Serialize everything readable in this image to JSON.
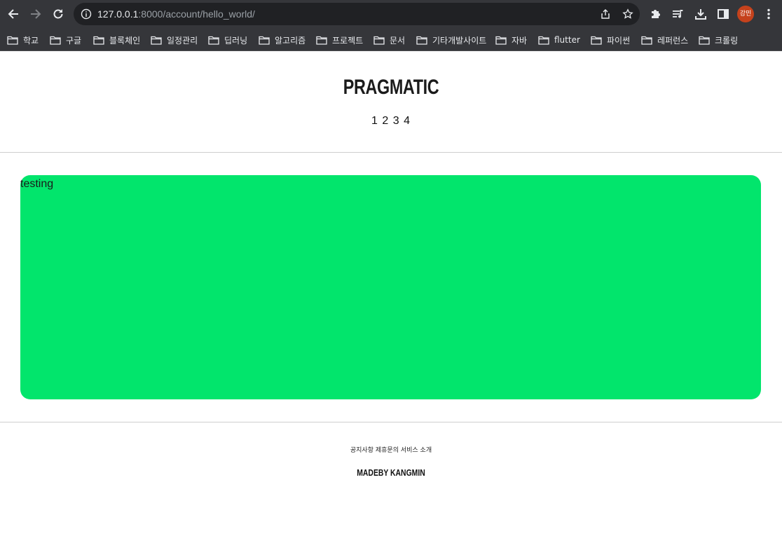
{
  "browser": {
    "url_host": "127.0.0.1",
    "url_rest": ":8000/account/hello_world/",
    "profile_initials": "강민",
    "bookmarks": [
      "학교",
      "구글",
      "블록체인",
      "일정관리",
      "딥러닝",
      "알고리즘",
      "프로젝트",
      "문서",
      "기타개발사이트",
      "자바",
      "flutter",
      "파이썬",
      "레퍼런스",
      "크롤링"
    ]
  },
  "page": {
    "logo": "PRAGMATIC",
    "nav": "1 2 3 4",
    "content_text": "testing",
    "content_color": "#02e56c",
    "footer_links": "공지사항 제휴문의 서비스 소개",
    "footer_brand": "MADEBY KANGMIN"
  }
}
